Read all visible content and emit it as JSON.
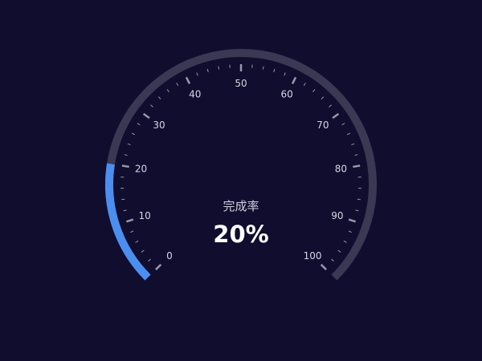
{
  "chart_data": {
    "type": "gauge",
    "title": "",
    "name": "完成率",
    "value": 20,
    "value_label": "20%",
    "min": 0,
    "max": 100,
    "tick_labels": [
      "0",
      "10",
      "20",
      "30",
      "40",
      "50",
      "60",
      "70",
      "80",
      "90",
      "100"
    ],
    "colors": {
      "background": "#110d2e",
      "track": "#3a3853",
      "progress": "#4b8ef0",
      "tick": "#9896ab",
      "label": "#d6d4e6",
      "value_text": "#ffffff"
    }
  }
}
